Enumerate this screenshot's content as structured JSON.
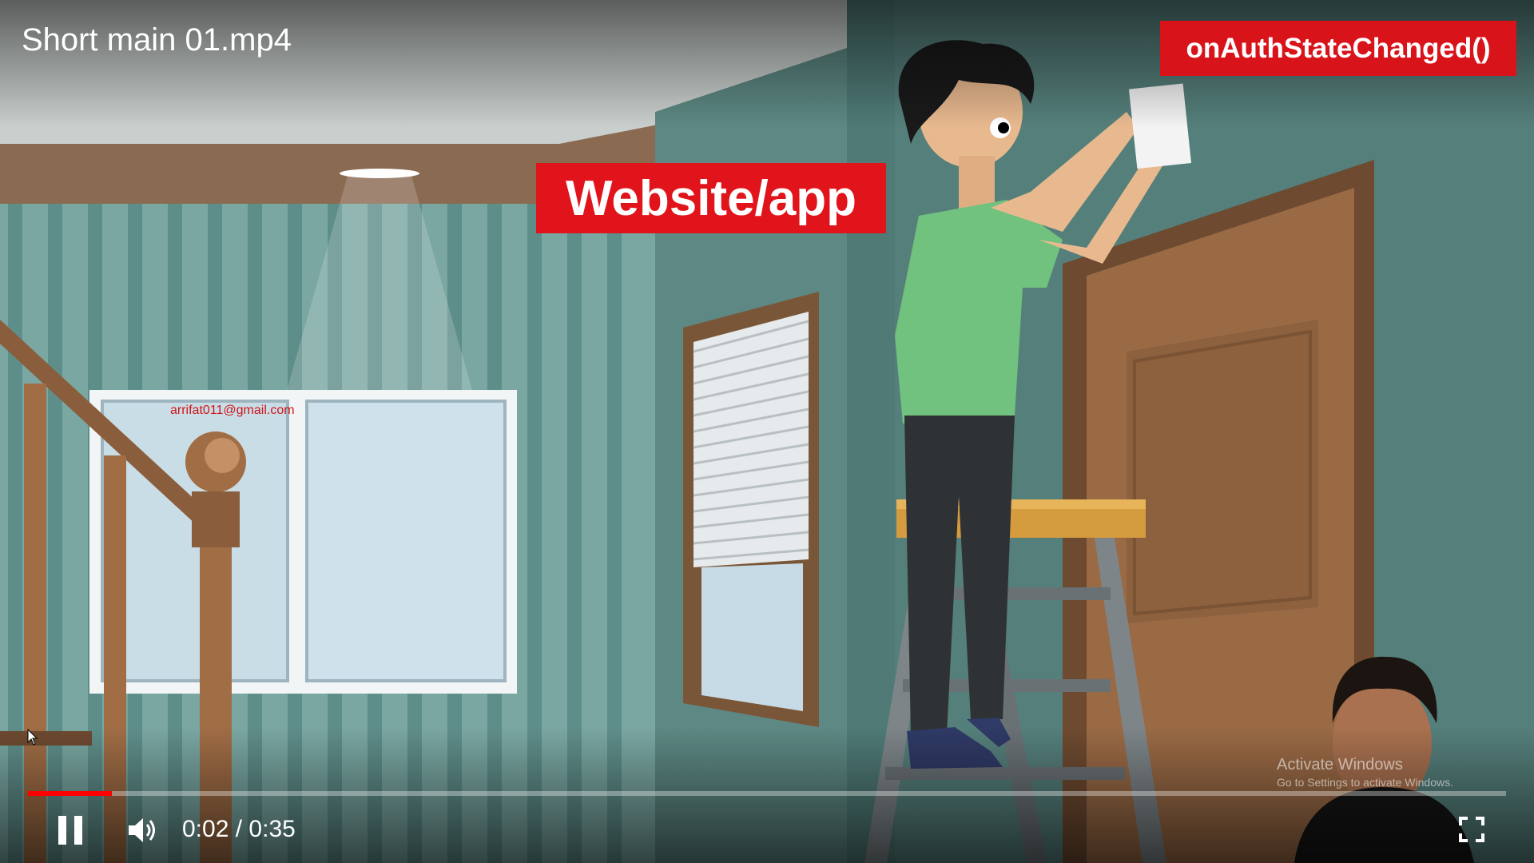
{
  "video": {
    "title": "Short main 01.mp4",
    "current_time": "0:02",
    "separator": "/",
    "duration": "0:35",
    "progress_fraction": 0.057
  },
  "overlay_labels": {
    "website_app": "Website/app",
    "auth_state": "onAuthStateChanged()"
  },
  "watermark": {
    "email": "arrifat011@gmail.com"
  },
  "system_notice": {
    "title": "Activate Windows",
    "subtitle": "Go to Settings to activate Windows."
  },
  "controls": {
    "pause_icon": "pause-icon",
    "volume_icon": "volume-icon",
    "fullscreen_icon": "fullscreen-icon"
  },
  "colors": {
    "progress_red": "#ff0000",
    "label_red": "#e0141a"
  }
}
